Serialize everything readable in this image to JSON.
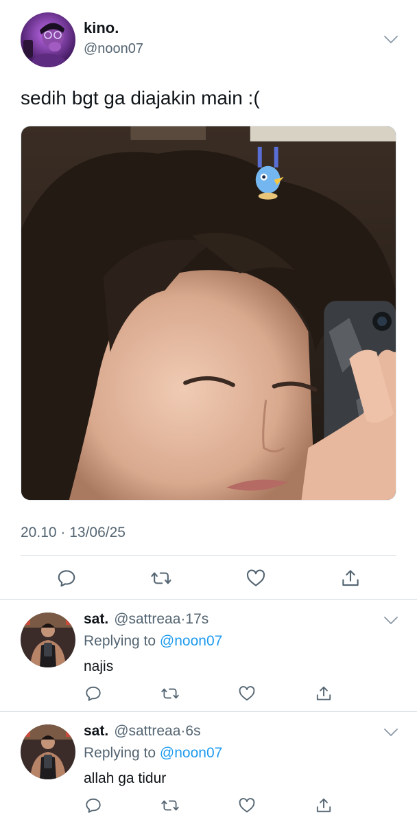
{
  "main_tweet": {
    "author_name": "kino.",
    "author_handle": "@noon07",
    "text": "sedih bgt ga diajakin main :(",
    "timestamp": "20.10 · 13/06/25",
    "media_description": "",
    "actions": [
      "reply-icon",
      "retweet-icon",
      "like-icon",
      "share-icon"
    ]
  },
  "replies": [
    {
      "author_name": "sat.",
      "author_handle": "@sattreaa",
      "separator": "·",
      "time": "17s",
      "replying_prefix": "Replying to ",
      "replying_to": "@noon07",
      "text": "najis"
    },
    {
      "author_name": "sat.",
      "author_handle": "@sattreaa",
      "separator": "·",
      "time": "6s",
      "replying_prefix": "Replying to ",
      "replying_to": "@noon07",
      "text": "allah ga tidur"
    }
  ],
  "colors": {
    "text_primary": "#0f1419",
    "text_secondary": "#536471",
    "link": "#1d9bf0",
    "divider": "#cfd9de",
    "icon": "#536471"
  }
}
